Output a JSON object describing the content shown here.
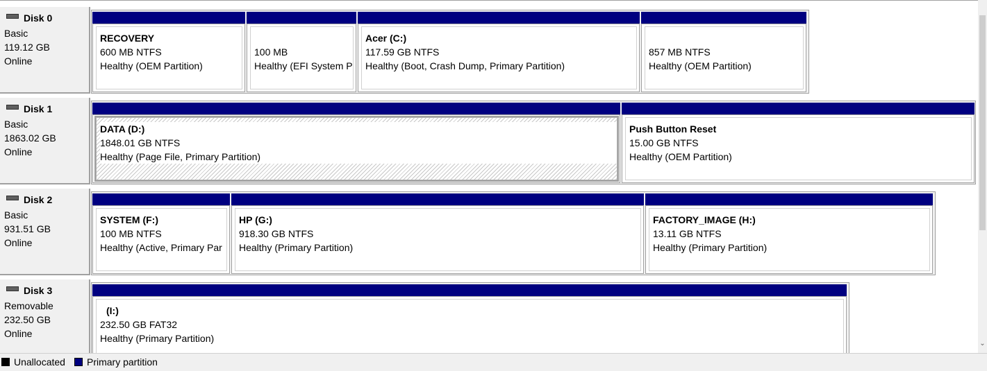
{
  "disks": [
    {
      "title": "Disk 0",
      "type": "Basic",
      "size": "119.12 GB",
      "status": "Online",
      "partitions": [
        {
          "name": "RECOVERY",
          "size": "600 MB NTFS",
          "status": "Healthy (OEM Partition)"
        },
        {
          "name": "",
          "size": "100 MB",
          "status": "Healthy (EFI System P"
        },
        {
          "name": "Acer  (C:)",
          "size": "117.59 GB NTFS",
          "status": "Healthy (Boot, Crash Dump, Primary Partition)"
        },
        {
          "name": "",
          "size": "857 MB NTFS",
          "status": "Healthy (OEM Partition)"
        }
      ]
    },
    {
      "title": "Disk 1",
      "type": "Basic",
      "size": "1863.02 GB",
      "status": "Online",
      "partitions": [
        {
          "name": "DATA  (D:)",
          "size": "1848.01 GB NTFS",
          "status": "Healthy (Page File, Primary Partition)"
        },
        {
          "name": "Push Button Reset",
          "size": "15.00 GB NTFS",
          "status": "Healthy (OEM Partition)"
        }
      ]
    },
    {
      "title": "Disk 2",
      "type": "Basic",
      "size": "931.51 GB",
      "status": "Online",
      "partitions": [
        {
          "name": "SYSTEM  (F:)",
          "size": "100 MB NTFS",
          "status": "Healthy (Active, Primary Par"
        },
        {
          "name": "HP  (G:)",
          "size": "918.30 GB NTFS",
          "status": "Healthy (Primary Partition)"
        },
        {
          "name": "FACTORY_IMAGE  (H:)",
          "size": "13.11 GB NTFS",
          "status": "Healthy (Primary Partition)"
        }
      ]
    },
    {
      "title": "Disk 3",
      "type": "Removable",
      "size": "232.50 GB",
      "status": "Online",
      "partitions": [
        {
          "name": "(I:)",
          "size": "232.50 GB FAT32",
          "status": "Healthy (Primary Partition)"
        }
      ]
    }
  ],
  "legend": {
    "unallocated": "Unallocated",
    "primary": "Primary partition",
    "unallocated_color": "#000000",
    "primary_color": "#000080"
  },
  "icons": {
    "disk": "disk-drive-icon",
    "scroll_down": "chevron-down-icon"
  }
}
